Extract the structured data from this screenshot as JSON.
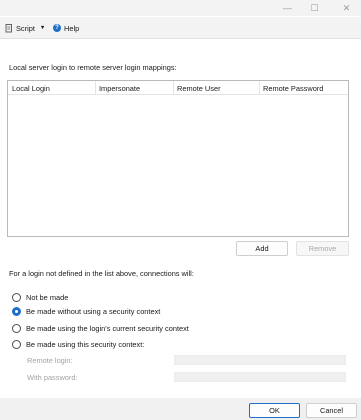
{
  "window": {
    "minimize_glyph": "—",
    "maximize_glyph": "☐",
    "close_glyph": "✕"
  },
  "toolbar": {
    "script_label": "Script",
    "script_icon": "script-icon",
    "dropdown_glyph": "▼",
    "help_label": "Help",
    "help_icon": "help-icon",
    "help_glyph": "?"
  },
  "mappings": {
    "section_label": "Local server login to remote server login mappings:",
    "columns": [
      "Local Login",
      "Impersonate",
      "Remote User",
      "Remote Password"
    ],
    "rows": [],
    "add_label": "Add",
    "remove_label": "Remove"
  },
  "undefined_logins": {
    "section_label": "For a login not defined in the list above, connections will:",
    "options": [
      {
        "label": "Not be made",
        "checked": false
      },
      {
        "label": "Be made without using a security context",
        "checked": true
      },
      {
        "label": "Be made using the login's current security context",
        "checked": false
      },
      {
        "label": "Be made using this security context:",
        "checked": false
      }
    ],
    "remote_login_label": "Remote login:",
    "remote_login_value": "",
    "with_password_label": "With password:",
    "with_password_value": ""
  },
  "footer": {
    "ok_label": "OK",
    "cancel_label": "Cancel"
  },
  "colors": {
    "accent": "#1e6fc8",
    "chrome_bg": "#f3f3f3",
    "disabled_text": "#a3a3a3"
  }
}
